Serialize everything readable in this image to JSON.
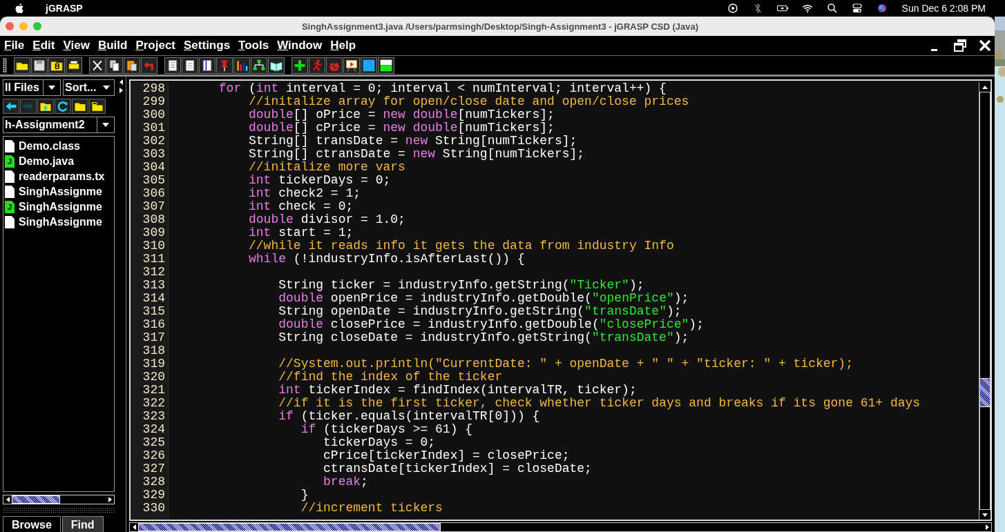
{
  "mac_menu_bar": {
    "app_name": "jGRASP",
    "clock": "Sun Dec 6  2:08 PM"
  },
  "window": {
    "title": "SinghAssignment3.java  /Users/parmsingh/Desktop/Singh-Assignment3 - jGRASP CSD (Java)"
  },
  "menu": [
    "File",
    "Edit",
    "View",
    "Build",
    "Project",
    "Settings",
    "Tools",
    "Window",
    "Help"
  ],
  "toolbar": {
    "folder_badge": "B"
  },
  "browser": {
    "filter": "ll Files",
    "sort": "Sort...",
    "path": "h-Assignment2",
    "files": [
      {
        "name": "Demo.class",
        "kind": "file"
      },
      {
        "name": "Demo.java",
        "kind": "java",
        "badge": "J"
      },
      {
        "name": "readerparams.tx",
        "kind": "file"
      },
      {
        "name": "SinghAssignme",
        "kind": "file"
      },
      {
        "name": "SinghAssignme",
        "kind": "java",
        "badge": "J"
      },
      {
        "name": "SinghAssignme",
        "kind": "file"
      }
    ],
    "tabs": [
      {
        "label": "Browse",
        "selected": true
      },
      {
        "label": "Find",
        "selected": false
      }
    ]
  },
  "editor": {
    "lines": [
      {
        "number": "298",
        "tokens": [
          {
            "kind": "keyword",
            "text": "      for"
          },
          {
            "kind": "plain",
            "text": " ("
          },
          {
            "kind": "keyword",
            "text": "int"
          },
          {
            "kind": "plain",
            "text": " interval = 0; interval < numInterval; interval++) {"
          }
        ]
      },
      {
        "number": "299",
        "tokens": [
          {
            "kind": "comment",
            "text": "          //initalize array for open/close date and open/close prices"
          }
        ]
      },
      {
        "number": "300",
        "tokens": [
          {
            "kind": "keyword",
            "text": "          double"
          },
          {
            "kind": "plain",
            "text": "[] oPrice = "
          },
          {
            "kind": "keyword",
            "text": "new double"
          },
          {
            "kind": "plain",
            "text": "[numTickers];"
          }
        ]
      },
      {
        "number": "301",
        "tokens": [
          {
            "kind": "keyword",
            "text": "          double"
          },
          {
            "kind": "plain",
            "text": "[] cPrice = "
          },
          {
            "kind": "keyword",
            "text": "new double"
          },
          {
            "kind": "plain",
            "text": "[numTickers];"
          }
        ]
      },
      {
        "number": "302",
        "tokens": [
          {
            "kind": "plain",
            "text": "          String[] transDate = "
          },
          {
            "kind": "keyword",
            "text": "new"
          },
          {
            "kind": "plain",
            "text": " String[numTickers];"
          }
        ]
      },
      {
        "number": "303",
        "tokens": [
          {
            "kind": "plain",
            "text": "          String[] ctransDate = "
          },
          {
            "kind": "keyword",
            "text": "new"
          },
          {
            "kind": "plain",
            "text": " String[numTickers];"
          }
        ]
      },
      {
        "number": "304",
        "tokens": [
          {
            "kind": "comment",
            "text": "          //initalize more vars"
          }
        ]
      },
      {
        "number": "305",
        "tokens": [
          {
            "kind": "keyword",
            "text": "          int"
          },
          {
            "kind": "plain",
            "text": " tickerDays = 0;"
          }
        ]
      },
      {
        "number": "306",
        "tokens": [
          {
            "kind": "keyword",
            "text": "          int"
          },
          {
            "kind": "plain",
            "text": " check2 = 1;"
          }
        ]
      },
      {
        "number": "307",
        "tokens": [
          {
            "kind": "keyword",
            "text": "          int"
          },
          {
            "kind": "plain",
            "text": " check = 0;"
          }
        ]
      },
      {
        "number": "308",
        "tokens": [
          {
            "kind": "keyword",
            "text": "          double"
          },
          {
            "kind": "plain",
            "text": " divisor = 1.0;"
          }
        ]
      },
      {
        "number": "309",
        "tokens": [
          {
            "kind": "keyword",
            "text": "          int"
          },
          {
            "kind": "plain",
            "text": " start = 1;"
          }
        ]
      },
      {
        "number": "310",
        "tokens": [
          {
            "kind": "comment",
            "text": "          //while it reads info it gets the data from industry Info"
          }
        ]
      },
      {
        "number": "311",
        "tokens": [
          {
            "kind": "keyword",
            "text": "          while"
          },
          {
            "kind": "plain",
            "text": " (!industryInfo.isAfterLast()) {"
          }
        ]
      },
      {
        "number": "312"
      },
      {
        "number": "313",
        "tokens": [
          {
            "kind": "plain",
            "text": "              String ticker = industryInfo.getString("
          },
          {
            "kind": "string",
            "text": "\"Ticker\""
          },
          {
            "kind": "plain",
            "text": ");"
          }
        ]
      },
      {
        "number": "314",
        "tokens": [
          {
            "kind": "keyword",
            "text": "              double"
          },
          {
            "kind": "plain",
            "text": " openPrice = industryInfo.getDouble("
          },
          {
            "kind": "string",
            "text": "\"openPrice\""
          },
          {
            "kind": "plain",
            "text": ");"
          }
        ]
      },
      {
        "number": "315",
        "tokens": [
          {
            "kind": "plain",
            "text": "              String openDate = industryInfo.getString("
          },
          {
            "kind": "string",
            "text": "\"transDate\""
          },
          {
            "kind": "plain",
            "text": ");"
          }
        ]
      },
      {
        "number": "316",
        "tokens": [
          {
            "kind": "keyword",
            "text": "              double"
          },
          {
            "kind": "plain",
            "text": " closePrice = industryInfo.getDouble("
          },
          {
            "kind": "string",
            "text": "\"closePrice\""
          },
          {
            "kind": "plain",
            "text": ");"
          }
        ]
      },
      {
        "number": "317",
        "tokens": [
          {
            "kind": "plain",
            "text": "              String closeDate = industryInfo.getString("
          },
          {
            "kind": "string",
            "text": "\"transDate\""
          },
          {
            "kind": "plain",
            "text": ");"
          }
        ]
      },
      {
        "number": "318"
      },
      {
        "number": "319",
        "tokens": [
          {
            "kind": "comment",
            "text": "              //System.out.println(\"CurrentDate: \" + openDate + \" \" + \"ticker: \" + ticker);"
          }
        ]
      },
      {
        "number": "320",
        "tokens": [
          {
            "kind": "comment",
            "text": "              //find the index of the ticker"
          }
        ]
      },
      {
        "number": "321",
        "tokens": [
          {
            "kind": "keyword",
            "text": "              int"
          },
          {
            "kind": "plain",
            "text": " tickerIndex = findIndex(intervalTR, ticker);"
          }
        ]
      },
      {
        "number": "322",
        "tokens": [
          {
            "kind": "comment",
            "text": "              //if it is the first ticker, check whether ticker days and breaks if its gone 61+ days"
          }
        ]
      },
      {
        "number": "323",
        "tokens": [
          {
            "kind": "keyword",
            "text": "              if"
          },
          {
            "kind": "plain",
            "text": " (ticker.equals(intervalTR[0])) {"
          }
        ]
      },
      {
        "number": "324",
        "tokens": [
          {
            "kind": "keyword",
            "text": "                 if"
          },
          {
            "kind": "plain",
            "text": " (tickerDays >= 61) {"
          }
        ]
      },
      {
        "number": "325",
        "tokens": [
          {
            "kind": "plain",
            "text": "                    tickerDays = 0;"
          }
        ]
      },
      {
        "number": "326",
        "tokens": [
          {
            "kind": "plain",
            "text": "                    cPrice[tickerIndex] = closePrice;"
          }
        ]
      },
      {
        "number": "327",
        "tokens": [
          {
            "kind": "plain",
            "text": "                    ctransDate[tickerIndex] = closeDate;"
          }
        ]
      },
      {
        "number": "328",
        "tokens": [
          {
            "kind": "keyword",
            "text": "                    break"
          },
          {
            "kind": "plain",
            "text": ";"
          }
        ]
      },
      {
        "number": "329",
        "tokens": [
          {
            "kind": "plain",
            "text": "                 }"
          }
        ]
      },
      {
        "number": "330",
        "tokens": [
          {
            "kind": "comment",
            "text": "                 //increment tickers"
          }
        ]
      }
    ]
  }
}
